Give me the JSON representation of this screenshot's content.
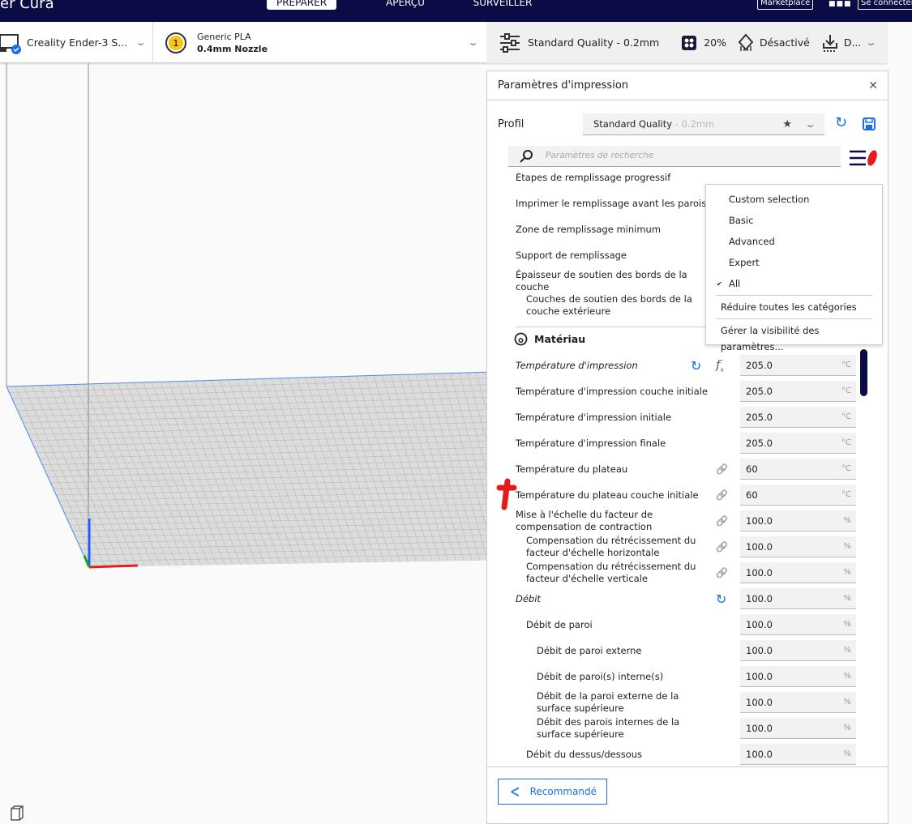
{
  "header": {
    "app_title": "er Cura",
    "tabs": [
      {
        "label": "PRÉPARER",
        "active": true
      },
      {
        "label": "APERÇU"
      },
      {
        "label": "SURVEILLER"
      }
    ],
    "marketplace_label": "Marketplace",
    "signin_label": "Se connecter"
  },
  "toolbar": {
    "printer_name": "Creality Ender-3 S...",
    "material_name": "Generic PLA",
    "nozzle": "0.4mm Nozzle",
    "extruder_number": "1",
    "quality": "Standard Quality - 0.2mm",
    "infill": "20%",
    "support": "Désactivé",
    "adhesion": "D..."
  },
  "panel": {
    "title": "Paramètres d'impression",
    "profile_label": "Profil",
    "profile_value": "Standard Quality",
    "profile_suffix": "- 0.2mm",
    "search_placeholder": "Paramètres de recherche",
    "category_material": "Matériau",
    "recommended_label": "Recommandé",
    "settings_above": [
      {
        "label": "Étapes de remplissage progressif"
      },
      {
        "label": "Imprimer le remplissage avant les parois"
      },
      {
        "label": "Zone de remplissage minimum"
      },
      {
        "label": "Support de remplissage"
      },
      {
        "label": "Épaisseur de soutien des bords de la couche"
      },
      {
        "label": "Couches de soutien des bords de la couche extérieure"
      }
    ],
    "settings": [
      {
        "label": "Température d'impression",
        "value": "205.0",
        "unit": "°C",
        "icons": [
          "reset-icon",
          "function-icon"
        ],
        "italic": true,
        "indent": 0
      },
      {
        "label": "Température d'impression couche initiale",
        "value": "205.0",
        "unit": "°C",
        "indent": 0
      },
      {
        "label": "Température d'impression initiale",
        "value": "205.0",
        "unit": "°C",
        "indent": 0
      },
      {
        "label": "Température d'impression finale",
        "value": "205.0",
        "unit": "°C",
        "indent": 0
      },
      {
        "label": "Température du plateau",
        "value": "60",
        "unit": "°C",
        "icons": [
          "link-icon"
        ],
        "indent": 0
      },
      {
        "label": "Température du plateau couche initiale",
        "value": "60",
        "unit": "°C",
        "icons": [
          "link-icon"
        ],
        "indent": 0
      },
      {
        "label": "Mise à l'échelle du facteur de compensation de contraction",
        "value": "100.0",
        "unit": "%",
        "icons": [
          "link-icon"
        ],
        "indent": 0
      },
      {
        "label": "Compensation du rétrécissement du facteur d'échelle horizontale",
        "value": "100.0",
        "unit": "%",
        "icons": [
          "link-icon"
        ],
        "indent": 1
      },
      {
        "label": "Compensation du rétrécissement du facteur d'échelle verticale",
        "value": "100.0",
        "unit": "%",
        "icons": [
          "link-icon"
        ],
        "indent": 1
      },
      {
        "label": "Débit",
        "value": "100.0",
        "unit": "%",
        "icons": [
          "reset-icon"
        ],
        "italic": true,
        "indent": 0
      },
      {
        "label": "Débit de paroi",
        "value": "100.0",
        "unit": "%",
        "indent": 1
      },
      {
        "label": "Débit de paroi externe",
        "value": "100.0",
        "unit": "%",
        "indent": 2
      },
      {
        "label": "Débit de paroi(s) interne(s)",
        "value": "100.0",
        "unit": "%",
        "indent": 2
      },
      {
        "label": "Débit de la paroi externe de la surface supérieure",
        "value": "100.0",
        "unit": "%",
        "indent": 2
      },
      {
        "label": "Débit des parois internes de la surface supérieure",
        "value": "100.0",
        "unit": "%",
        "indent": 2
      },
      {
        "label": "Débit du dessus/dessous",
        "value": "100.0",
        "unit": "%",
        "indent": 1
      }
    ]
  },
  "visibility_menu": {
    "items": [
      {
        "label": "Custom selection"
      },
      {
        "label": "Basic"
      },
      {
        "label": "Advanced"
      },
      {
        "label": "Expert"
      },
      {
        "label": "All",
        "checked": true
      }
    ],
    "collapse_label": "Réduire toutes les catégories",
    "manage_label": "Gérer la visibilité des paramètres..."
  },
  "colors": {
    "header_bg": "#0b0b45",
    "accent": "#196ef0",
    "annotation": "#e31b1b"
  }
}
